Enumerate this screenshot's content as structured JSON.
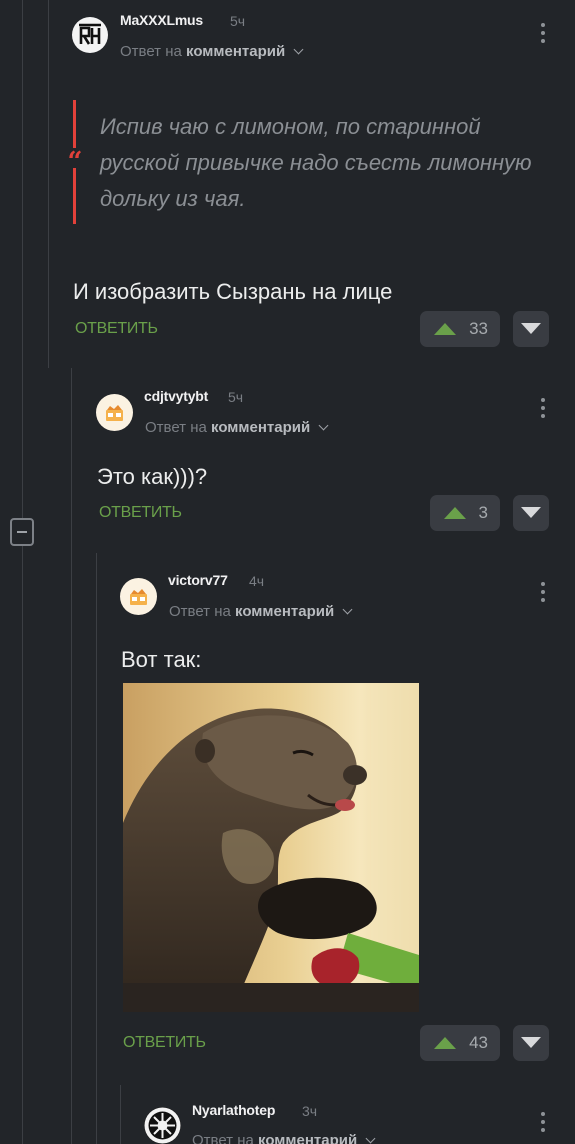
{
  "comments": [
    {
      "author": "MaXXXLmus",
      "time": "5ч",
      "reply_prefix": "Ответ на",
      "reply_target": "комментарий",
      "quote": "Испив чаю с лимоном, по старинной русской привычке надо съесть лимонную дольку из чая.",
      "text": "И изобразить Сызрань на лице",
      "reply_label": "ОТВЕТИТЬ",
      "rating": "33"
    },
    {
      "author": "cdjtvytybt",
      "time": "5ч",
      "reply_prefix": "Ответ на",
      "reply_target": "комментарий",
      "text": "Это как)))?",
      "reply_label": "ОТВЕТИТЬ",
      "rating": "3"
    },
    {
      "author": "victorv77",
      "time": "4ч",
      "reply_prefix": "Ответ на",
      "reply_target": "комментарий",
      "text": "Вот так:",
      "reply_label": "ОТВЕТИТЬ",
      "rating": "43"
    },
    {
      "author": "Nyarlathotep",
      "time": "3ч",
      "reply_prefix": "Ответ на",
      "reply_target": "комментарий"
    }
  ],
  "colors": {
    "background": "#222529",
    "accent_green": "#6aa04a",
    "quote_red": "#e2413a"
  },
  "icons": [
    "kebab-menu-icon",
    "chevron-down-icon",
    "upvote-arrow-icon",
    "downvote-arrow-icon",
    "quote-mark-icon",
    "collapse-thread-icon"
  ]
}
